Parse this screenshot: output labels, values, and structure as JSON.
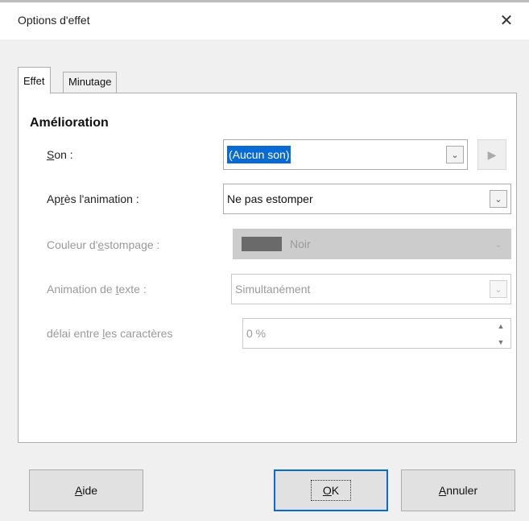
{
  "window": {
    "title": "Options d'effet",
    "close_glyph": "✕"
  },
  "tabs": [
    {
      "label": "Effet",
      "active": true
    },
    {
      "label": "Minutage",
      "active": false
    }
  ],
  "section": {
    "title": "Amélioration"
  },
  "fields": {
    "son": {
      "label_u": "S",
      "label_rest": "on :",
      "value": "(Aucun son)",
      "icon": "chevron-down-icon"
    },
    "apres_animation": {
      "label_pre": "Ap",
      "label_u": "r",
      "label_rest": "ès l'animation :",
      "value": "Ne pas estomper"
    },
    "couleur": {
      "label_pre": "Couleur d'",
      "label_u": "e",
      "label_rest": "stompage :",
      "value": "Noir",
      "swatch_color": "#6a6a6a"
    },
    "animation_texte": {
      "label_pre": "Animation de ",
      "label_u": "t",
      "label_rest": "exte :",
      "value": "Simultanément"
    },
    "delai": {
      "label_pre": "délai entre ",
      "label_u": "l",
      "label_rest": "es caractères",
      "value": "0 %"
    }
  },
  "play_button": {
    "glyph": "▶"
  },
  "glyphs": {
    "caret": "⌄",
    "spin_up": "▲",
    "spin_down": "▼"
  },
  "buttons": {
    "aide": {
      "u": "A",
      "rest": "ide"
    },
    "ok": {
      "u": "O",
      "rest": "K"
    },
    "annuler": {
      "u": "A",
      "rest": "nnuler"
    }
  },
  "colors": {
    "accent": "#0a6ad4",
    "dialog_bg": "#f0f0f0",
    "disabled_text": "#9a9a9a"
  }
}
